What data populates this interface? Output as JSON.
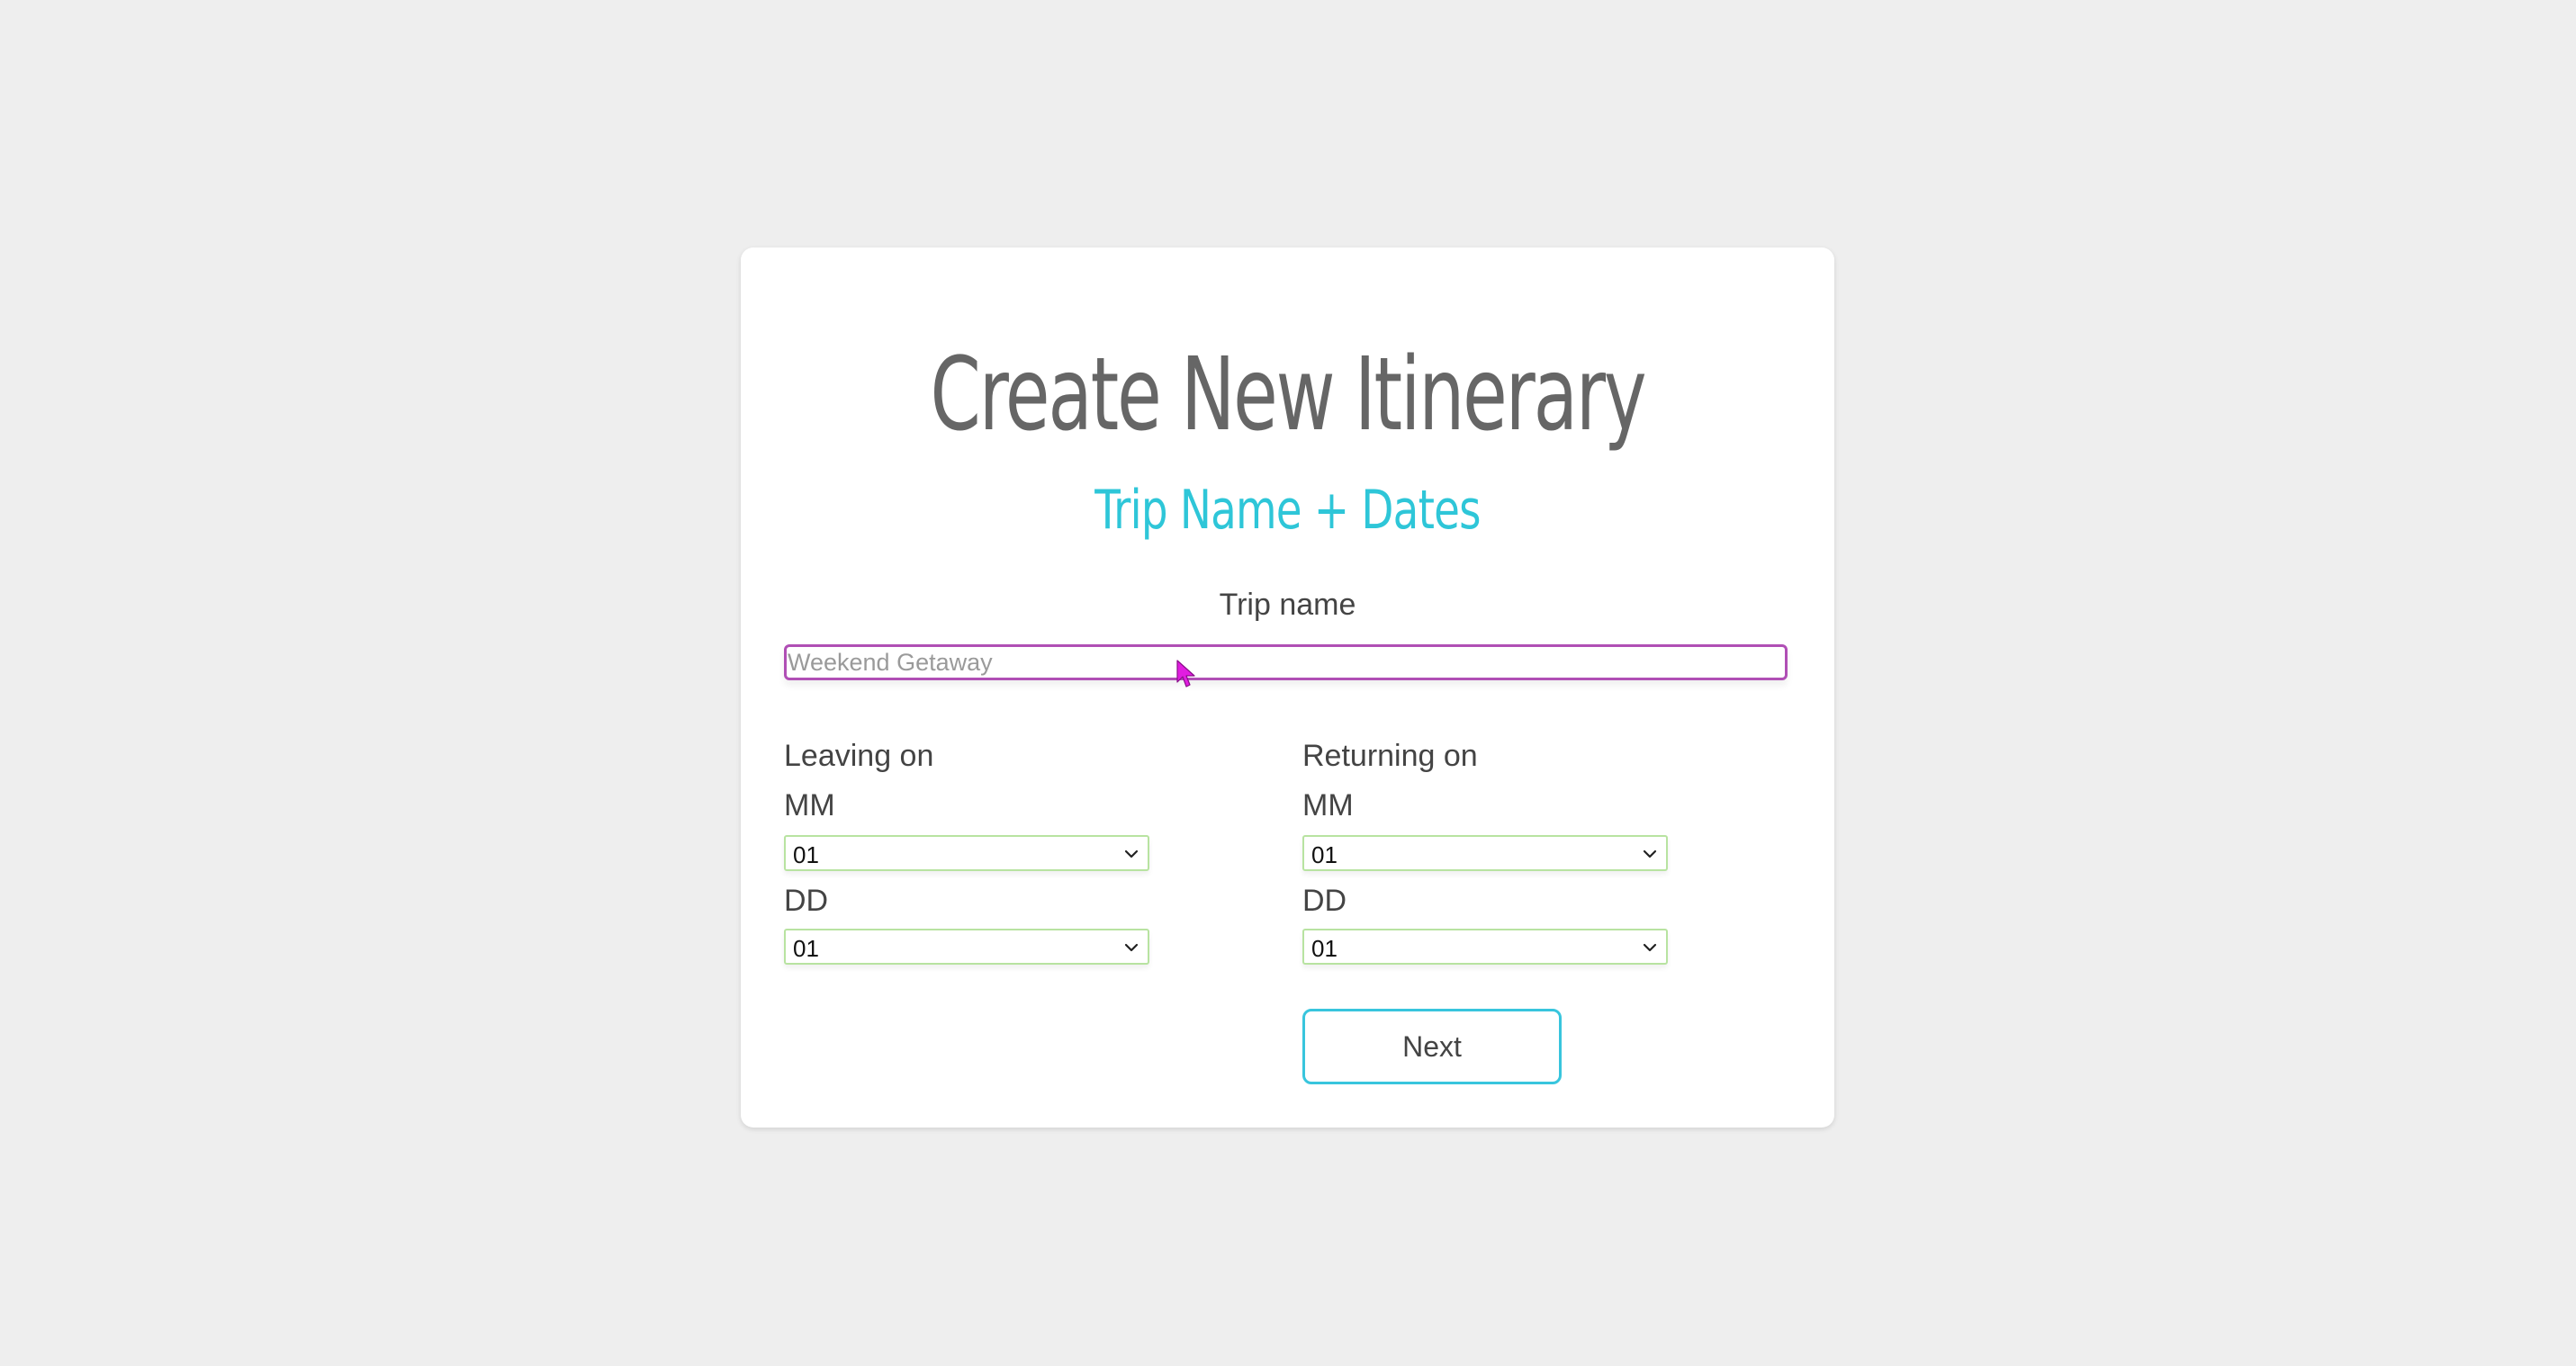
{
  "header": {
    "title": "Create New Itinerary",
    "subtitle": "Trip Name + Dates"
  },
  "trip_name": {
    "label": "Trip name",
    "value": "",
    "placeholder": "Weekend Getaway"
  },
  "leaving": {
    "heading": "Leaving on",
    "month_label": "MM",
    "month_value": "01",
    "day_label": "DD",
    "day_value": "01"
  },
  "returning": {
    "heading": "Returning on",
    "month_label": "MM",
    "month_value": "01",
    "day_label": "DD",
    "day_value": "01"
  },
  "next_button": {
    "label": "Next"
  },
  "icons": {
    "select_arrow": "chevron-down-icon",
    "pointer": "mouse-cursor-icon"
  },
  "colors": {
    "subtitle": "#2ec6d8",
    "input_focus_border": "#b04fb5",
    "select_border": "#b8e3a1",
    "button_border": "#38c5dd",
    "cursor": "#e11de0"
  }
}
